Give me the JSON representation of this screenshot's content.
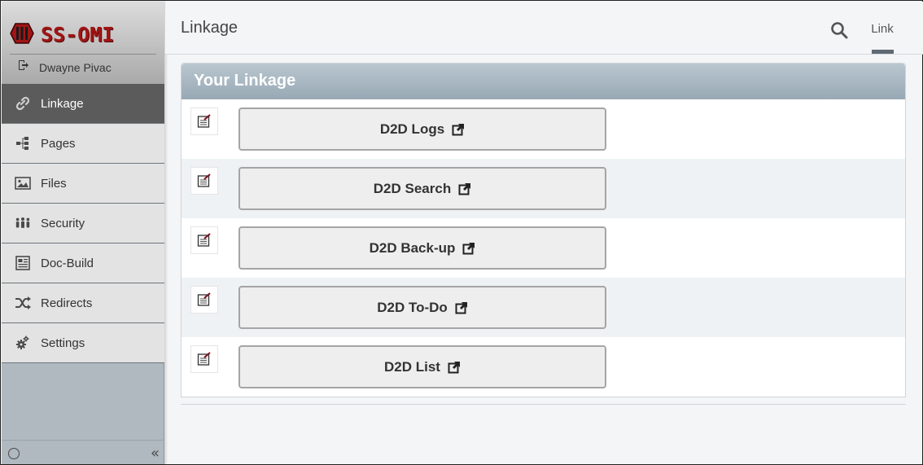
{
  "brand": {
    "name": "SS-OMI",
    "color": "#a01515"
  },
  "user": {
    "name": "Dwayne Pivac",
    "icon": "sign-out-icon"
  },
  "sidebar": {
    "items": [
      {
        "label": "Linkage",
        "icon": "link-icon",
        "active": true
      },
      {
        "label": "Pages",
        "icon": "sitemap-icon",
        "active": false
      },
      {
        "label": "Files",
        "icon": "image-icon",
        "active": false
      },
      {
        "label": "Security",
        "icon": "users-icon",
        "active": false
      },
      {
        "label": "Doc-Build",
        "icon": "newspaper-icon",
        "active": false
      },
      {
        "label": "Redirects",
        "icon": "shuffle-icon",
        "active": false
      },
      {
        "label": "Settings",
        "icon": "cogs-icon",
        "active": false
      }
    ],
    "footer": {
      "collapse_glyph": "«"
    }
  },
  "header": {
    "title": "Linkage",
    "tabs": [
      {
        "label": "Link",
        "active": true
      }
    ]
  },
  "panel": {
    "title": "Your Linkage",
    "links": [
      {
        "label": "D2D Logs"
      },
      {
        "label": "D2D Search"
      },
      {
        "label": "D2D Back-up"
      },
      {
        "label": "D2D To-Do"
      },
      {
        "label": "D2D List"
      }
    ]
  },
  "colors": {
    "active_nav": "#5b5b5b",
    "panel_header": "#98a9b5",
    "sidebar_bg": "#b0b9c0"
  }
}
